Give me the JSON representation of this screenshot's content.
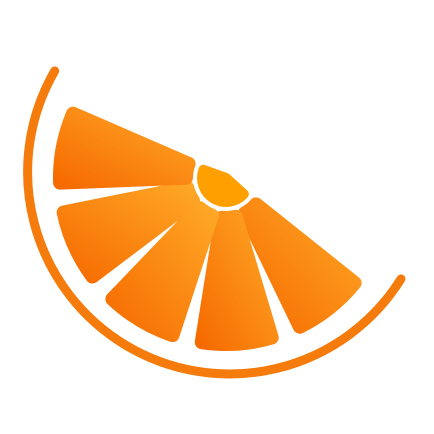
{
  "logo": {
    "icon": "orange-slice-icon",
    "colors": {
      "rind": "#F57C0C",
      "segment_dark": "#F66B00",
      "segment_light": "#FFA726",
      "pith": "#FFFFFF",
      "center": "#FFA000",
      "background": "#FFFFFF"
    }
  }
}
